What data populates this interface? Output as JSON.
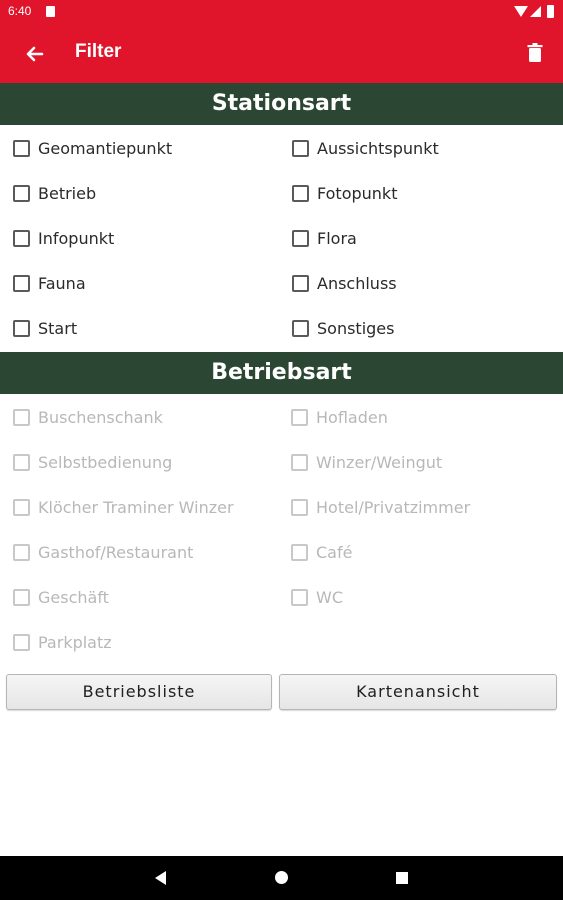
{
  "status_bar": {
    "time": "6:40"
  },
  "app_bar": {
    "title": "Filter"
  },
  "stationsart": {
    "header": "Stationsart",
    "left": [
      "Geomantiepunkt",
      "Betrieb",
      "Infopunkt",
      "Fauna",
      "Start"
    ],
    "right": [
      "Aussichtspunkt",
      "Fotopunkt",
      "Flora",
      "Anschluss",
      "Sonstiges"
    ]
  },
  "betriebsart": {
    "header": "Betriebsart",
    "left": [
      "Buschenschank",
      "Selbstbedienung",
      "Klöcher Traminer Winzer",
      "Gasthof/Restaurant",
      "Geschäft",
      "Parkplatz"
    ],
    "right": [
      "Hofladen",
      "Winzer/Weingut",
      "Hotel/Privatzimmer",
      "Café",
      "WC"
    ]
  },
  "buttons": {
    "list_label": "Betriebsliste",
    "map_label": "Kartenansicht"
  },
  "colors": {
    "accent": "#e0142a",
    "section_header": "#2b4632"
  }
}
